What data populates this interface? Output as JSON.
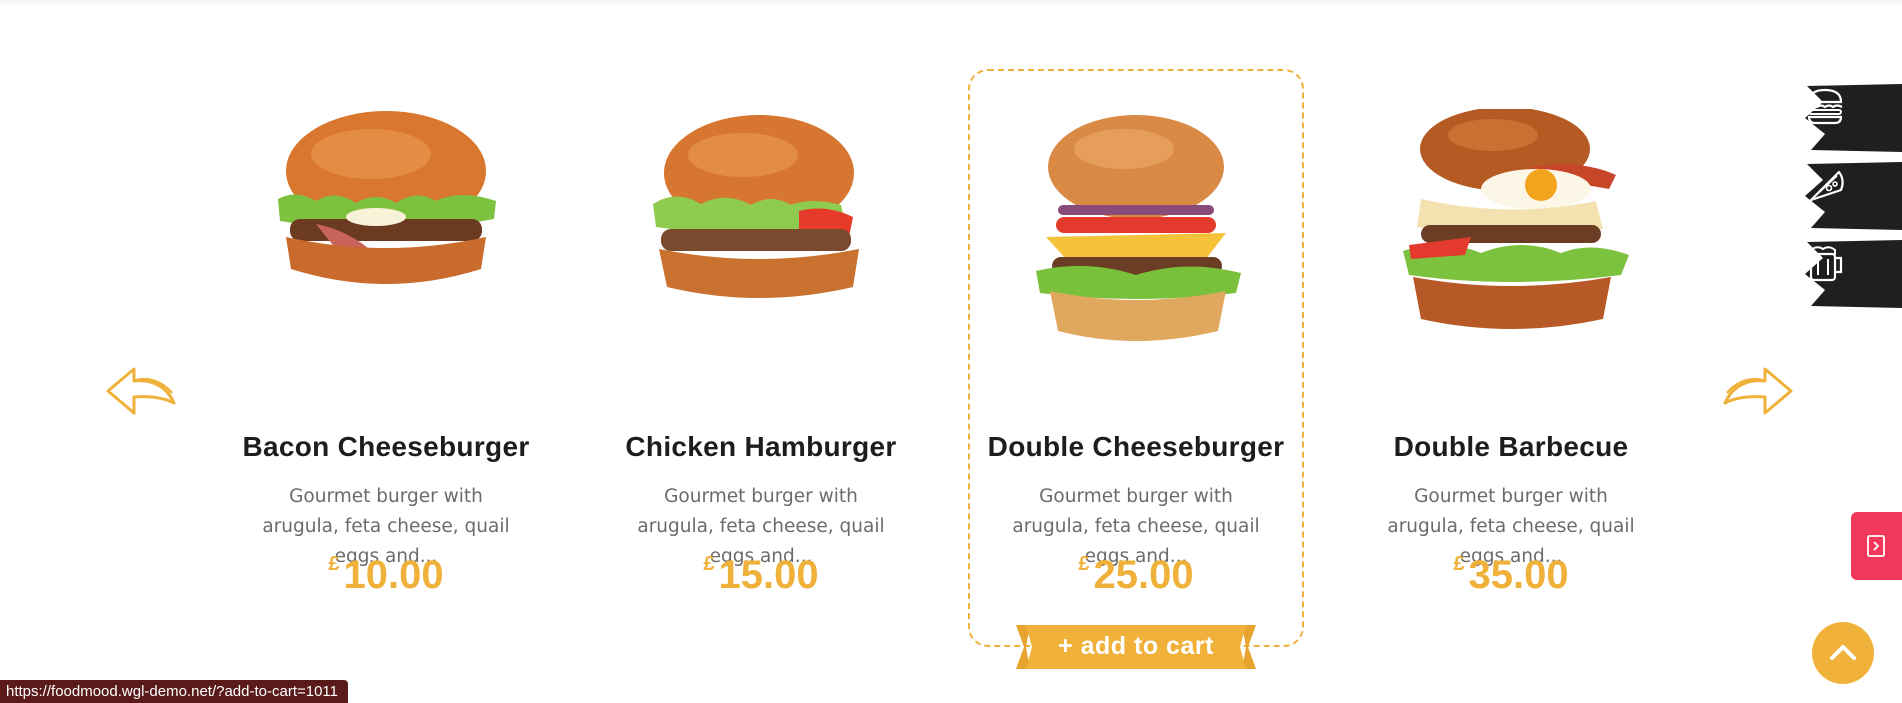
{
  "products": [
    {
      "title": "Bacon Cheeseburger",
      "description": "Gourmet burger with arugula, feta cheese, quail eggs and...",
      "currency": "£",
      "price": "10.00"
    },
    {
      "title": "Chicken Hamburger",
      "description": "Gourmet burger with arugula, feta cheese, quail eggs and...",
      "currency": "£",
      "price": "15.00"
    },
    {
      "title": "Double Cheeseburger",
      "description": "Gourmet burger with arugula, feta cheese, quail eggs and...",
      "currency": "£",
      "price": "25.00",
      "cta": "+ add to cart"
    },
    {
      "title": "Double Barbecue",
      "description": "Gourmet burger with arugula, feta cheese, quail eggs and...",
      "currency": "£",
      "price": "35.00"
    }
  ],
  "navigation": {
    "prev_icon": "arrow-left-icon",
    "next_icon": "arrow-right-icon"
  },
  "side_menu": [
    {
      "icon": "burger-icon"
    },
    {
      "icon": "pizza-icon"
    },
    {
      "icon": "beer-mug-icon"
    }
  ],
  "floating": {
    "cart_icon": "exit-door-icon",
    "scroll_icon": "chevron-up-icon"
  },
  "status_bar": {
    "url": "https://foodmood.wgl-demo.net/?add-to-cart=1011"
  },
  "colors": {
    "accent": "#f0b13a",
    "red": "#f1385a",
    "dark": "#1d1d1d",
    "text": "#6b6b6b"
  }
}
